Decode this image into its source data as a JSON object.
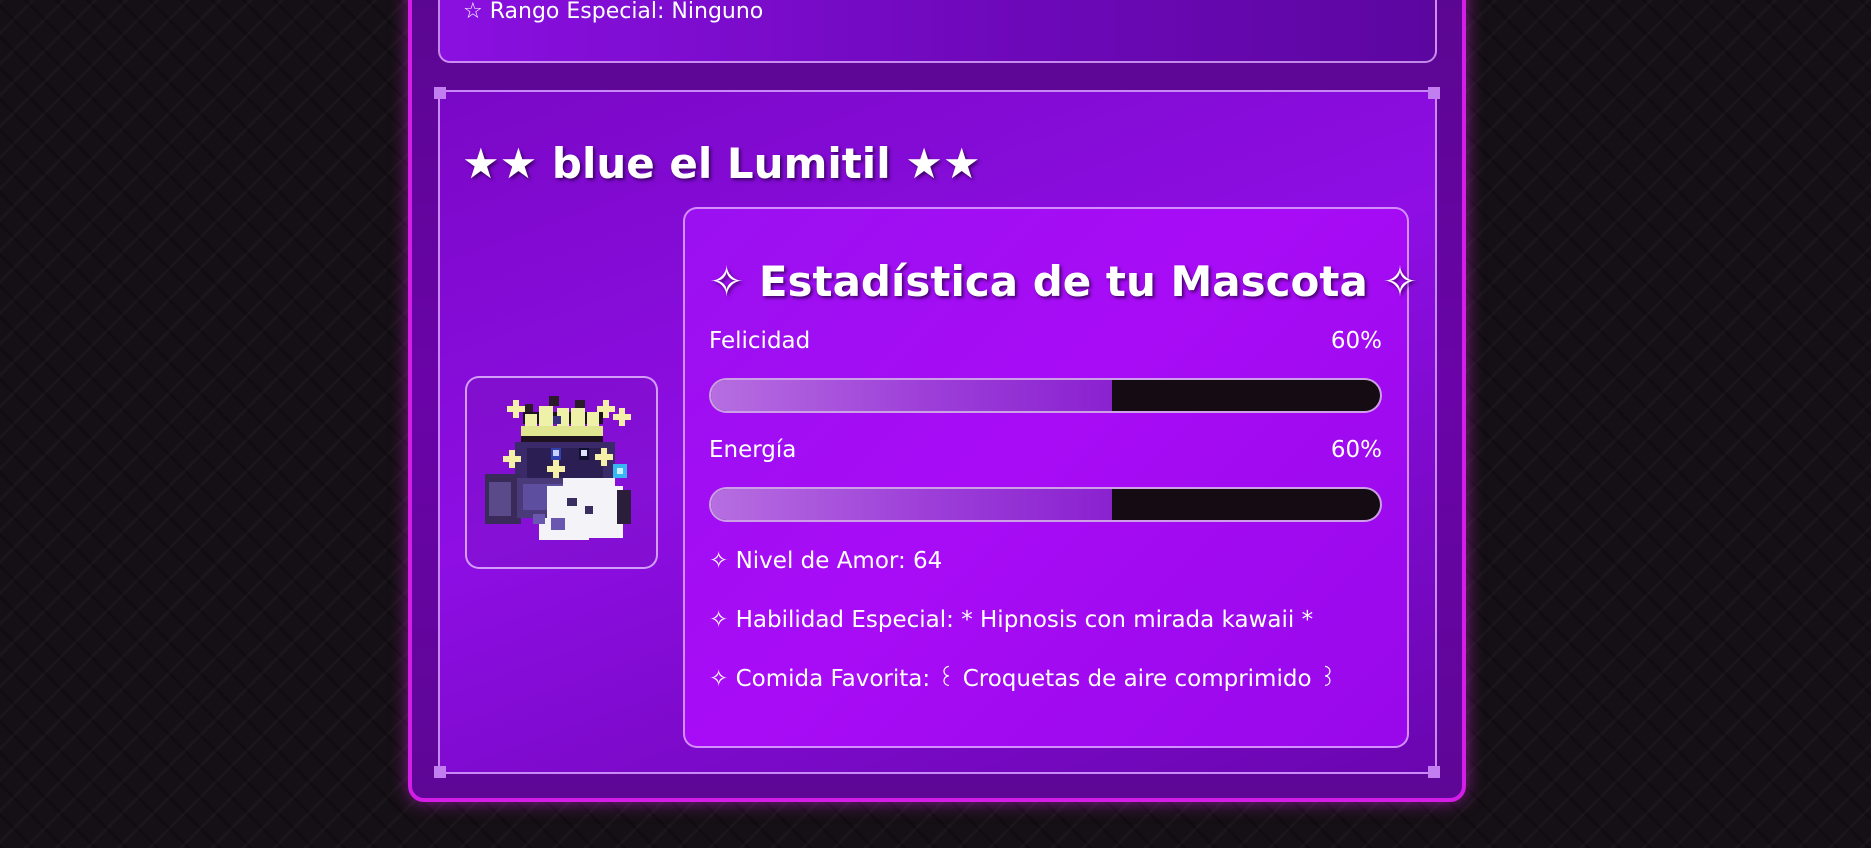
{
  "previous_card": {
    "rank_line": "☆ Rango Especial: Ninguno"
  },
  "pet": {
    "title": "★★ blue el Lumitil ★★",
    "avatar_name": "blue el Lumitil sprite"
  },
  "stats": {
    "title": "✧ Estadística de tu Mascota ✧",
    "happiness": {
      "label": "Felicidad",
      "value_text": "60%",
      "value": 60
    },
    "energy": {
      "label": "Energía",
      "value_text": "60%",
      "value": 60
    },
    "love_level": "✧ Nivel de Amor: 64",
    "special_skill": "✧ Habilidad Especial: * Hipnosis con mirada kawaii *",
    "favorite_food": "✧ Comida Favorita: ꒰ Croquetas de aire comprimido ꒱"
  },
  "colors": {
    "border_magenta": "#d41ee8",
    "panel_purple": "#6a04a8",
    "card_purple": "#a80cf6",
    "bar_fill": "#9c3ed8",
    "bar_track": "#140c12"
  }
}
